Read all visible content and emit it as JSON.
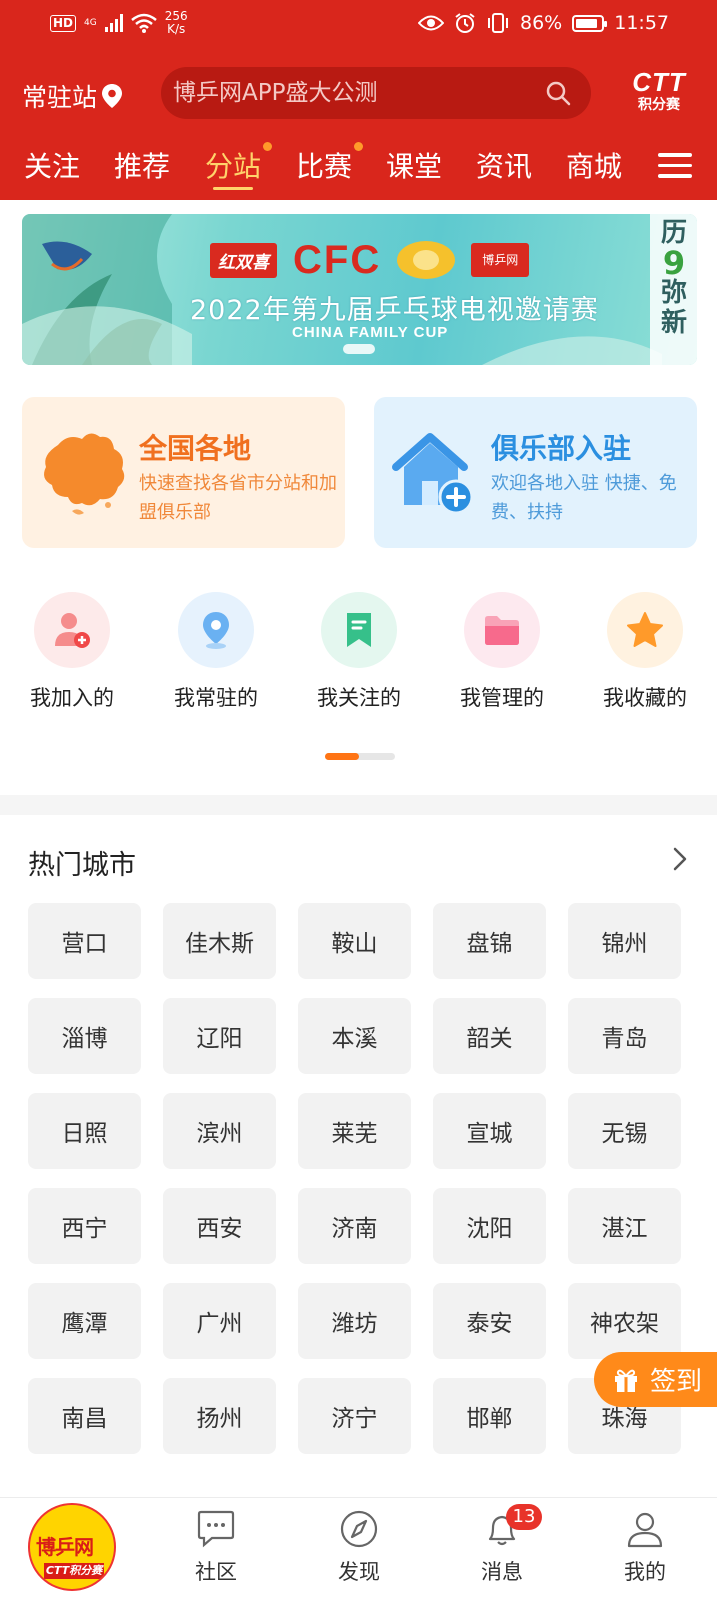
{
  "status_bar": {
    "hd": "HD",
    "network": "4G",
    "speed_value": "256",
    "speed_unit": "K/s",
    "battery": "86%",
    "battery_level": 0.86,
    "time": "11:57"
  },
  "header": {
    "station_label": "常驻站",
    "search_placeholder": "博乒网APP盛大公测",
    "logo_big": "CTT",
    "logo_small": "积分赛"
  },
  "nav_tabs": [
    {
      "label": "关注",
      "active": false,
      "dot": false
    },
    {
      "label": "推荐",
      "active": false,
      "dot": false
    },
    {
      "label": "分站",
      "active": true,
      "dot": true
    },
    {
      "label": "比赛",
      "active": false,
      "dot": true
    },
    {
      "label": "课堂",
      "active": false,
      "dot": false
    },
    {
      "label": "资讯",
      "active": false,
      "dot": false
    },
    {
      "label": "商城",
      "active": false,
      "dot": false
    }
  ],
  "banner": {
    "logo_dhs": "红双喜",
    "logo_cfc": "CFC",
    "logo_bp": "博乒网",
    "title": "2022年第九届乒乓球电视邀请赛",
    "subtitle": "CHINA FAMILY CUP",
    "side_text_1": "历",
    "side_text_2": "9",
    "side_text_3": "弥",
    "side_text_4": "新"
  },
  "cards": [
    {
      "title": "全国各地",
      "desc": "快速查找各省市分站和加盟俱乐部",
      "color": "#f0701f"
    },
    {
      "title": "俱乐部入驻",
      "desc": "欢迎各地入驻 快捷、免费、扶持",
      "color": "#2b8fe0"
    }
  ],
  "quick_actions": [
    {
      "label": "我加入的",
      "icon": "user-add-icon",
      "bg": "#fdeaea",
      "color": "#f05a5a"
    },
    {
      "label": "我常驻的",
      "icon": "location-pin-icon",
      "bg": "#e6f2fd",
      "color": "#5aa6ee"
    },
    {
      "label": "我关注的",
      "icon": "bookmark-icon",
      "bg": "#e4f7ef",
      "color": "#36c08a"
    },
    {
      "label": "我管理的",
      "icon": "folder-icon",
      "bg": "#fde9ef",
      "color": "#f76a8c"
    },
    {
      "label": "我收藏的",
      "icon": "star-icon",
      "bg": "#fff2e0",
      "color": "#ff9a2a"
    }
  ],
  "hot_cities": {
    "title": "热门城市",
    "rows": [
      [
        "营口",
        "佳木斯",
        "鞍山",
        "盘锦",
        "锦州"
      ],
      [
        "淄博",
        "辽阳",
        "本溪",
        "韶关",
        "青岛"
      ],
      [
        "日照",
        "滨州",
        "莱芜",
        "宣城",
        "无锡"
      ],
      [
        "西宁",
        "西安",
        "济南",
        "沈阳",
        "湛江"
      ],
      [
        "鹰潭",
        "广州",
        "潍坊",
        "泰安",
        "神农架"
      ],
      [
        "南昌",
        "扬州",
        "济宁",
        "邯郸",
        "珠海"
      ]
    ]
  },
  "sign_in": {
    "label": "签到"
  },
  "bottom_nav": {
    "logo_text": "博乒网",
    "logo_sub": "CTT积分赛",
    "items": [
      {
        "label": "社区",
        "icon": "chat-bubble-icon"
      },
      {
        "label": "发现",
        "icon": "compass-icon"
      },
      {
        "label": "消息",
        "icon": "bell-icon",
        "badge": "13"
      },
      {
        "label": "我的",
        "icon": "user-icon"
      }
    ]
  },
  "colors": {
    "header_red": "#d9261c",
    "accent_yellow": "#ffd36b",
    "accent_orange": "#ff7414"
  }
}
